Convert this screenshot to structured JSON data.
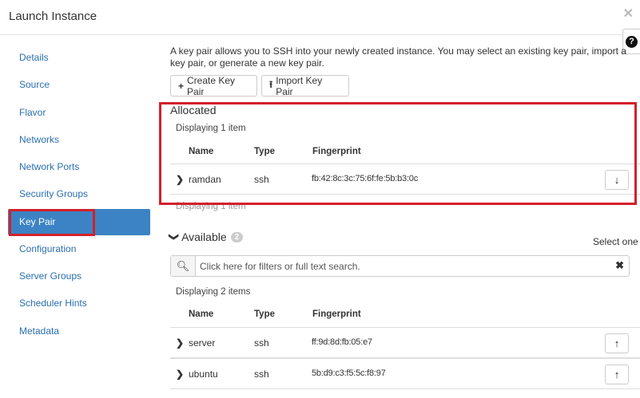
{
  "modal": {
    "title": "Launch Instance",
    "close_glyph": "✕",
    "help_glyph": "?"
  },
  "sidebar": {
    "items": [
      {
        "label": "Details"
      },
      {
        "label": "Source"
      },
      {
        "label": "Flavor"
      },
      {
        "label": "Networks"
      },
      {
        "label": "Network Ports"
      },
      {
        "label": "Security Groups"
      },
      {
        "label": "Key Pair",
        "active": true
      },
      {
        "label": "Configuration"
      },
      {
        "label": "Server Groups"
      },
      {
        "label": "Scheduler Hints"
      },
      {
        "label": "Metadata"
      }
    ]
  },
  "main": {
    "intro": "A key pair allows you to SSH into your newly created instance. You may select an existing key pair, import a key pair, or generate a new key pair.",
    "create_button": {
      "icon": "plus-icon",
      "glyph": "+",
      "label": "Create Key Pair"
    },
    "import_button": {
      "icon": "upload-icon",
      "glyph": "⭱",
      "label": "Import Key Pair"
    }
  },
  "allocated": {
    "title": "Allocated",
    "displaying": "Displaying 1 item",
    "displaying_footer": "Displaying 1 item",
    "columns": {
      "name": "Name",
      "type": "Type",
      "fingerprint": "Fingerprint"
    },
    "rows": [
      {
        "name": "ramdan",
        "type": "ssh",
        "fingerprint": "fb:42:8c:3c:75:6f:fe:5b:b3:0c",
        "action_glyph": "↓"
      }
    ]
  },
  "available": {
    "title": "Available",
    "count": "2",
    "select_hint": "Select one",
    "search_placeholder": "Click here for filters or full text search.",
    "search_glyph": "🔍",
    "clear_glyph": "✖",
    "displaying": "Displaying 2 items",
    "columns": {
      "name": "Name",
      "type": "Type",
      "fingerprint": "Fingerprint"
    },
    "rows": [
      {
        "name": "server",
        "type": "ssh",
        "fingerprint": "ff:9d:8d:fb:05:e7",
        "action_glyph": "↑"
      },
      {
        "name": "ubuntu",
        "type": "ssh",
        "fingerprint": "5b:d9:c3:f5:5c:f8:97",
        "action_glyph": "↑"
      }
    ]
  },
  "colors": {
    "accent": "#3b83c4",
    "link": "#2a6faf",
    "highlight": "#d3202a"
  }
}
